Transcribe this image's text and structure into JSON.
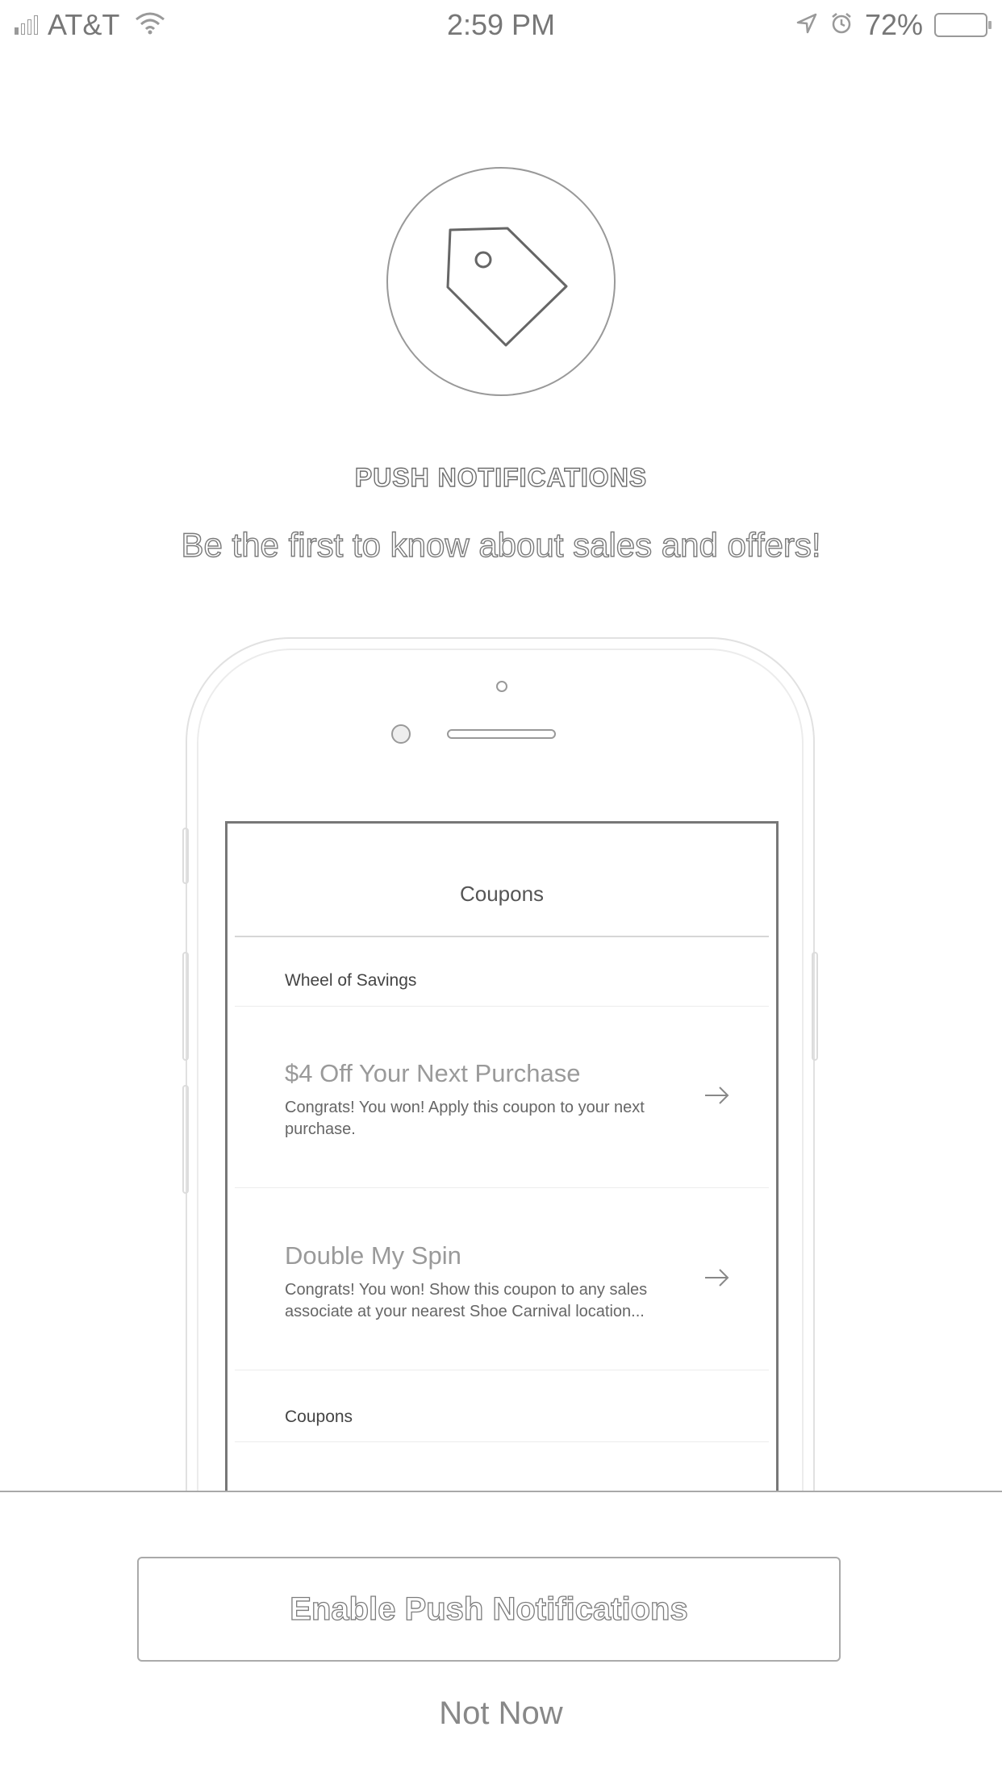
{
  "status_bar": {
    "carrier": "AT&T",
    "time": "2:59 PM",
    "battery_percent": "72%",
    "signal_bars_filled": 1,
    "signal_bars_total": 4,
    "icons": [
      "signal-icon",
      "wifi-icon",
      "location-icon",
      "alarm-icon",
      "battery-icon"
    ]
  },
  "hero": {
    "icon": "price-tag-icon",
    "heading": "PUSH NOTIFICATIONS",
    "subheading": "Be the first to know about sales and offers!"
  },
  "preview": {
    "screen_title": "Coupons",
    "sections": [
      {
        "label": "Wheel of Savings"
      },
      {
        "label": "Coupons"
      }
    ],
    "coupons": [
      {
        "title": "$4 Off Your Next Purchase",
        "description": "Congrats! You won! Apply this coupon to your next purchase.",
        "icon": "arrow-right-icon"
      },
      {
        "title": "Double My Spin",
        "description": "Congrats! You won! Show this coupon to any sales associate at your nearest Shoe Carnival location...",
        "icon": "arrow-right-icon"
      }
    ]
  },
  "actions": {
    "enable_label": "Enable Push Notifications",
    "dismiss_label": "Not Now"
  },
  "colors": {
    "background": "#ffffff",
    "text_gray": "#777777",
    "border_gray": "#aaaaaa"
  }
}
